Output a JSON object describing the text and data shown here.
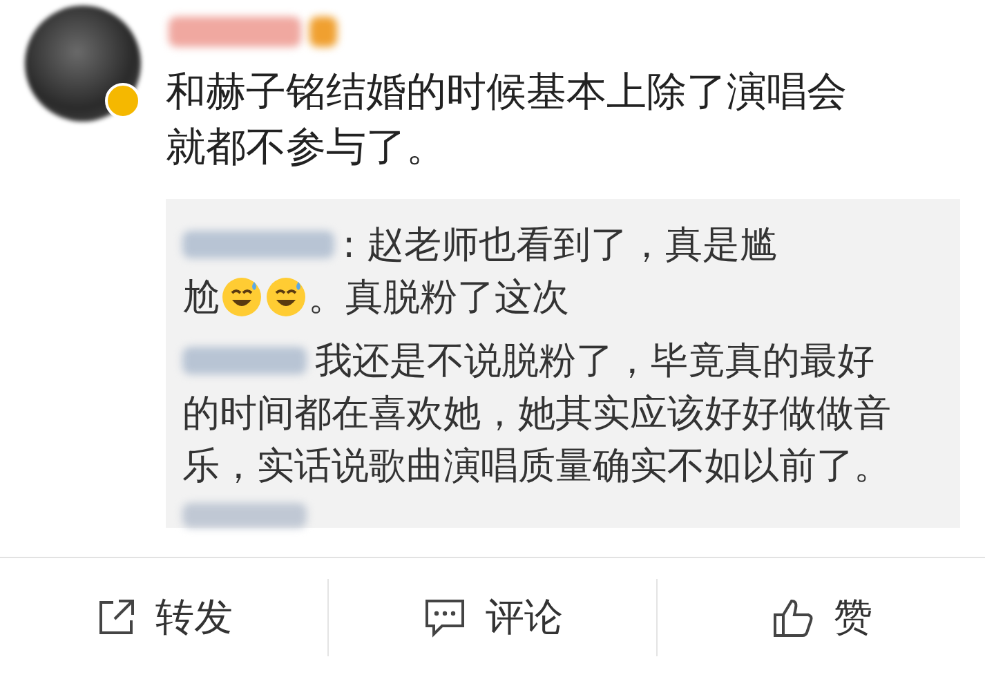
{
  "post": {
    "lines": [
      "和赫子铭结婚的时候基本上除了演唱会",
      "就都不参与了。"
    ]
  },
  "replies": [
    {
      "lines": [
        [
          {
            "kind": "text",
            "text": ": 赵老师也看到了，真是尴"
          }
        ],
        [
          {
            "kind": "text",
            "text": "尬"
          },
          {
            "kind": "emoji"
          },
          {
            "kind": "emoji"
          },
          {
            "kind": "text",
            "text": "。真脱粉了这次"
          }
        ]
      ]
    },
    {
      "lines": [
        [
          {
            "kind": "text",
            "text": "我还是不说脱粉了，毕竟真的最好"
          }
        ],
        [
          {
            "kind": "text",
            "text": "的时间都在喜欢她，她其实应该好好做做音"
          }
        ],
        [
          {
            "kind": "text",
            "text": "乐，实话说歌曲演唱质量确实不如以前了。"
          }
        ]
      ]
    }
  ],
  "actions": [
    {
      "kind": "share",
      "label": "转发"
    },
    {
      "kind": "comment",
      "label": "评论"
    },
    {
      "kind": "like",
      "label": "赞"
    }
  ]
}
